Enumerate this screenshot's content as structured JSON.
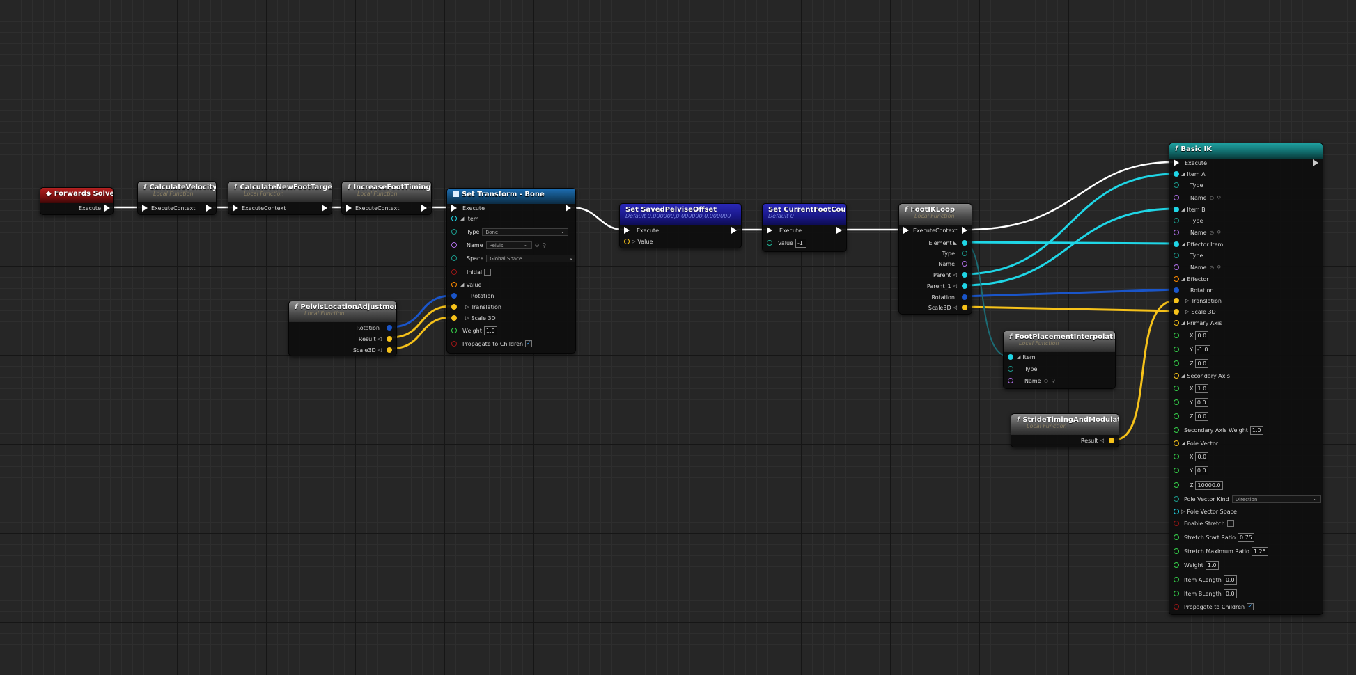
{
  "colors": {
    "exec": "#ffffff",
    "struct_blue": "#1a55c9",
    "element_cyan": "#1fd6e6",
    "vector_yellow": "#f6c21a",
    "name_purple": "#b070e8",
    "float_green": "#35d14a",
    "bool_red": "#9b1616",
    "type_teal": "#1b9a8c",
    "enum_orange": "#ff8a00"
  },
  "nodes": {
    "forwards_solve": {
      "title": "Forwards Solve",
      "execute": "Execute"
    },
    "calculate_velocity": {
      "title": "CalculateVelocity",
      "sub": "Local Function",
      "pin": "ExecuteContext"
    },
    "calculate_new_foot_targets": {
      "title": "CalculateNewFootTargets",
      "sub": "Local Function",
      "pin": "ExecuteContext"
    },
    "increase_foot_timings": {
      "title": "IncreaseFootTimings",
      "sub": "Local Function",
      "pin": "ExecuteContext"
    },
    "set_transform_bone": {
      "title": "Set Transform - Bone",
      "execute": "Execute",
      "item": "Item",
      "type_label": "Type",
      "type_value": "Bone",
      "name_label": "Name",
      "name_value": "Pelvis",
      "space_label": "Space",
      "space_value": "Global Space",
      "initial_label": "Initial",
      "value_label": "Value",
      "rotation": "Rotation",
      "translation": "Translation",
      "scale": "Scale 3D",
      "weight_label": "Weight",
      "weight_value": "1.0",
      "propagate": "Propagate to Children"
    },
    "pelvis_adjustments": {
      "title": "PelvisLocationAdjustments",
      "sub": "Local Function",
      "rotation": "Rotation",
      "result": "Result",
      "scale": "Scale3D"
    },
    "set_saved_pelvise_offset": {
      "title": "Set SavedPelviseOffset",
      "sub": "Default 0.000000,0.000000,0.000000",
      "execute": "Execute",
      "value": "Value"
    },
    "set_current_foot_count": {
      "title": "Set CurrentFootCount",
      "sub": "Default 0",
      "execute": "Execute",
      "value_label": "Value",
      "value": "-1"
    },
    "foot_ik_loop": {
      "title": "FootIKLoop",
      "sub": "Local Function",
      "pin": "ExecuteContext",
      "element": "Element",
      "type": "Type",
      "name": "Name",
      "parent": "Parent",
      "parent1": "Parent_1",
      "rotation": "Rotation",
      "scale": "Scale3D"
    },
    "foot_placement": {
      "title": "FootPlacementInterpolation",
      "sub": "Local Function",
      "item": "Item",
      "type": "Type",
      "name": "Name"
    },
    "stride_timing": {
      "title": "StrideTimingAndModulation",
      "sub": "Local Function",
      "result": "Result"
    },
    "basic_ik": {
      "title": "Basic IK",
      "execute": "Execute",
      "item_a": "Item A",
      "item_b": "Item B",
      "effector_item": "Effector Item",
      "type": "Type",
      "name": "Name",
      "effector": "Effector",
      "rotation": "Rotation",
      "translation": "Translation",
      "scale": "Scale 3D",
      "primary_axis": "Primary Axis",
      "secondary_axis": "Secondary Axis",
      "pole_vector": "Pole Vector",
      "x": "X",
      "y": "Y",
      "z": "Z",
      "primary_x": "0.0",
      "primary_y": "-1.0",
      "primary_z": "0.0",
      "secondary_x": "1.0",
      "secondary_y": "0.0",
      "secondary_z": "0.0",
      "secondary_weight_label": "Secondary Axis Weight",
      "secondary_weight": "1.0",
      "pole_x": "0.0",
      "pole_y": "0.0",
      "pole_z": "10000.0",
      "pole_kind_label": "Pole Vector Kind",
      "pole_kind": "Direction",
      "pole_space": "Pole Vector Space",
      "enable_stretch": "Enable Stretch",
      "stretch_start_label": "Stretch Start Ratio",
      "stretch_start": "0.75",
      "stretch_max_label": "Stretch Maximum Ratio",
      "stretch_max": "1.25",
      "weight_label": "Weight",
      "weight": "1.0",
      "a_length_label": "Item ALength",
      "a_length": "0.0",
      "b_length_label": "Item BLength",
      "b_length": "0.0",
      "propagate": "Propagate to Children"
    }
  }
}
